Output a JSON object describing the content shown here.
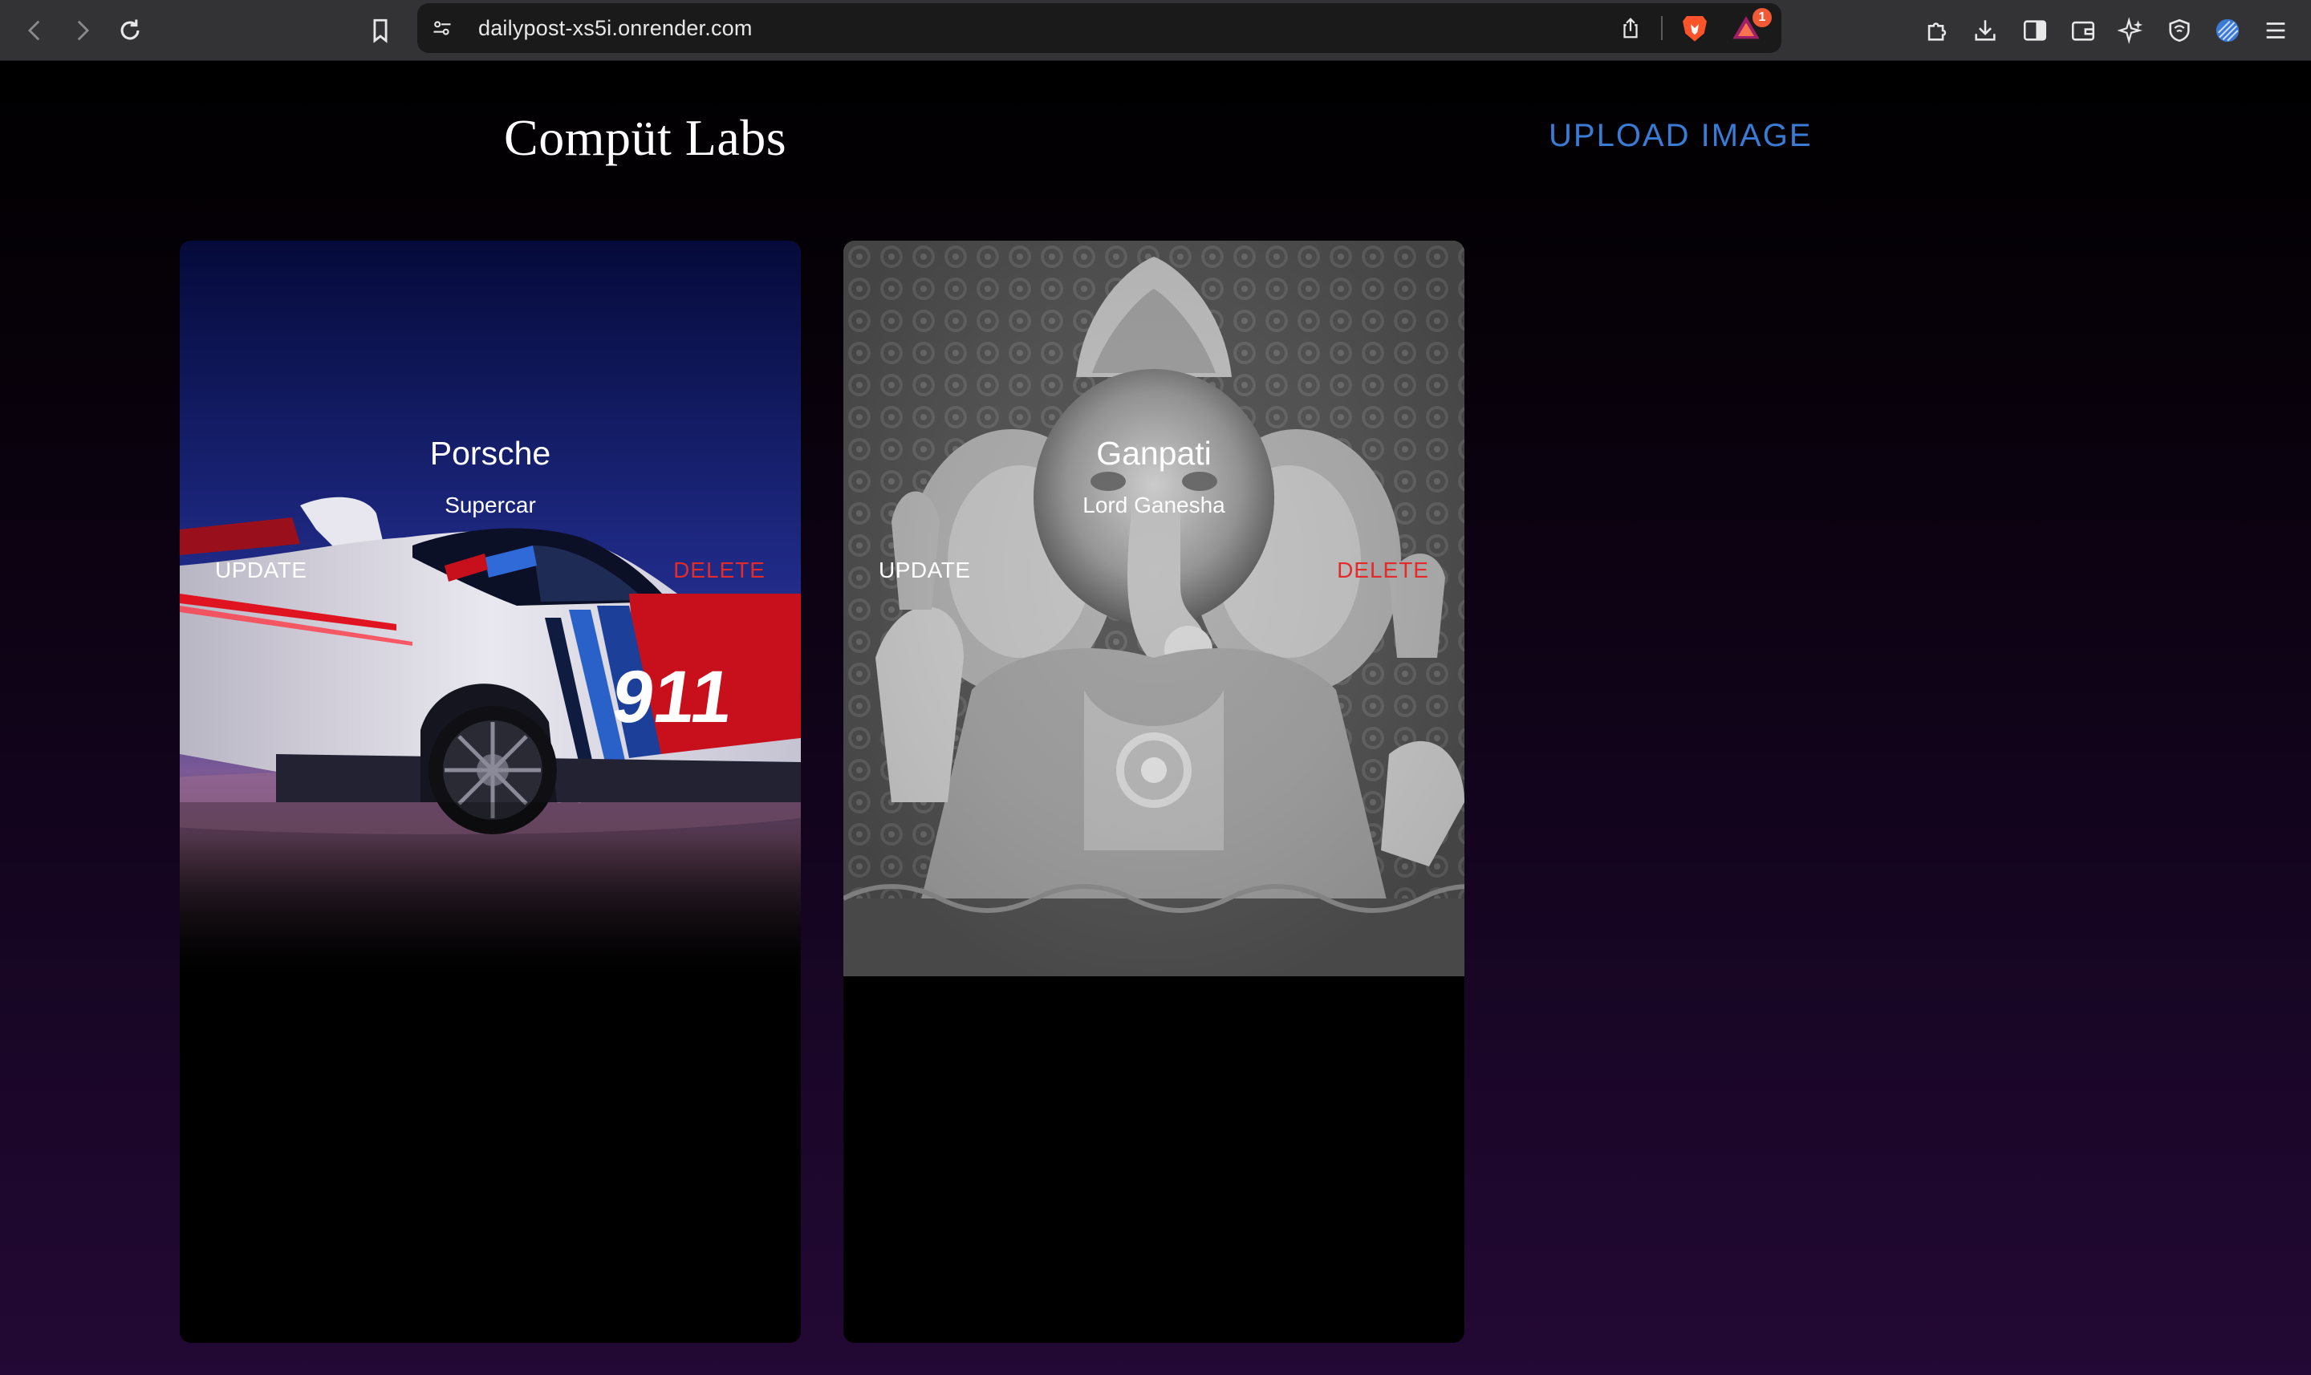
{
  "browser": {
    "url": "dailypost-xs5i.onrender.com",
    "notification_count": "1",
    "icons": [
      "back-icon",
      "forward-icon",
      "reload-icon",
      "bookmark-icon",
      "site-settings-icon",
      "share-icon",
      "brave-shields-icon",
      "brave-rewards-icon",
      "extensions-icon",
      "downloads-icon",
      "sidebar-icon",
      "wallet-icon",
      "leo-ai-icon",
      "vpn-icon",
      "profile-icon",
      "menu-icon"
    ]
  },
  "header": {
    "brand": "Compüt Labs",
    "upload_label": "UPLOAD IMAGE"
  },
  "posts": [
    {
      "title": "Porsche",
      "subtitle": "Supercar",
      "image": "porsche-race-car-image",
      "update_label": "UPDATE",
      "delete_label": "DELETE",
      "car_number": "911",
      "car_brand": "PORSCHE"
    },
    {
      "title": "Ganpati",
      "subtitle": "Lord Ganesha",
      "image": "ganesha-statue-image",
      "update_label": "UPDATE",
      "delete_label": "DELETE"
    }
  ],
  "colors": {
    "accent": "#3a7bd5",
    "danger": "#e42a2a",
    "background_top": "#000000",
    "background_bottom": "#230935",
    "chrome": "#333335"
  }
}
